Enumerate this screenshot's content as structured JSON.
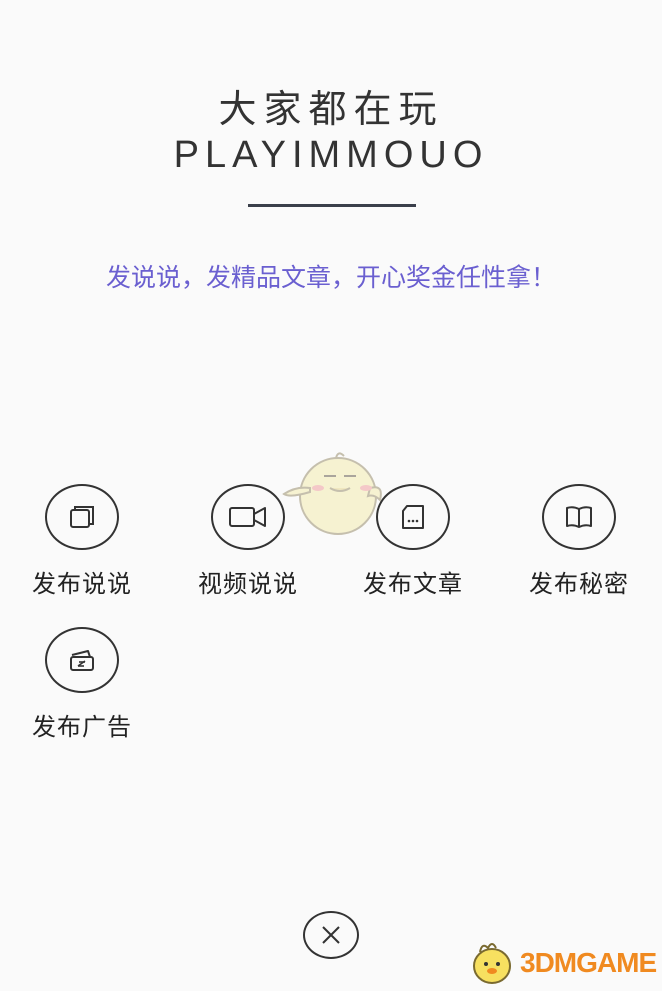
{
  "header": {
    "title_cn": "大家都在玩",
    "title_en": "PLAYIMMOUO"
  },
  "slogan": "发说说，发精品文章，开心奖金任性拿！",
  "actions": [
    {
      "label": "发布说说",
      "icon": "cards-icon"
    },
    {
      "label": "视频说说",
      "icon": "video-camera-icon"
    },
    {
      "label": "发布文章",
      "icon": "document-icon"
    },
    {
      "label": "发布秘密",
      "icon": "open-book-icon"
    },
    {
      "label": "发布广告",
      "icon": "ticket-icon"
    }
  ],
  "close": {
    "icon": "close-icon"
  },
  "watermark": {
    "text": "3DMGAME"
  },
  "colors": {
    "accent": "#6a5fd0",
    "watermark": "#f08a20",
    "outline": "#333333"
  }
}
